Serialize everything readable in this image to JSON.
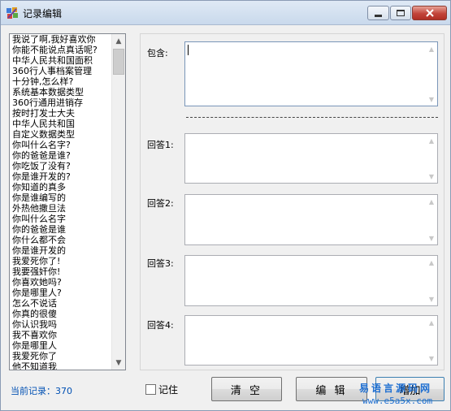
{
  "window": {
    "title": "记录编辑",
    "accent": "#c2443a"
  },
  "list": {
    "items": [
      "我说了啊,我好喜欢你",
      "你能不能说点真话呢?",
      "中华人民共和国面积",
      "360行人事档案管理",
      "十分钟,怎么样?",
      "系统基本数据类型",
      "360行通用进销存",
      "按时打发士大夫",
      "中华人民共和国",
      "自定义数据类型",
      "你叫什么名字?",
      "你的爸爸是谁?",
      "你吃饭了没有?",
      "你是谁开发的?",
      "你知道的真多",
      "你是谁编写的",
      "外热他撒旦法",
      "你叫什么名字",
      "你的爸爸是谁",
      "你什么都不会",
      "你是谁开发的",
      "我爱死你了!",
      "我要强奸你!",
      "你喜欢她吗?",
      "你是哪里人?",
      "怎么不说话",
      "你真的很傻",
      "你认识我吗",
      "我不喜欢你",
      "你是哪里人",
      "我爱死你了",
      "他不知道我"
    ],
    "count_label": "当前记录：370"
  },
  "form": {
    "contains_label": "包含:",
    "answer1_label": "回答1:",
    "answer2_label": "回答2:",
    "answer3_label": "回答3:",
    "answer4_label": "回答4:",
    "contains_value": "",
    "answer1_value": "",
    "answer2_value": "",
    "answer3_value": "",
    "answer4_value": ""
  },
  "controls": {
    "remember_label": "记住",
    "remember_checked": false,
    "clear_label": "清 空",
    "edit_label": "编 辑",
    "add_label": "增加"
  },
  "watermark": {
    "line1": "易语言源码网",
    "line2": "www.e5a5x.com"
  }
}
